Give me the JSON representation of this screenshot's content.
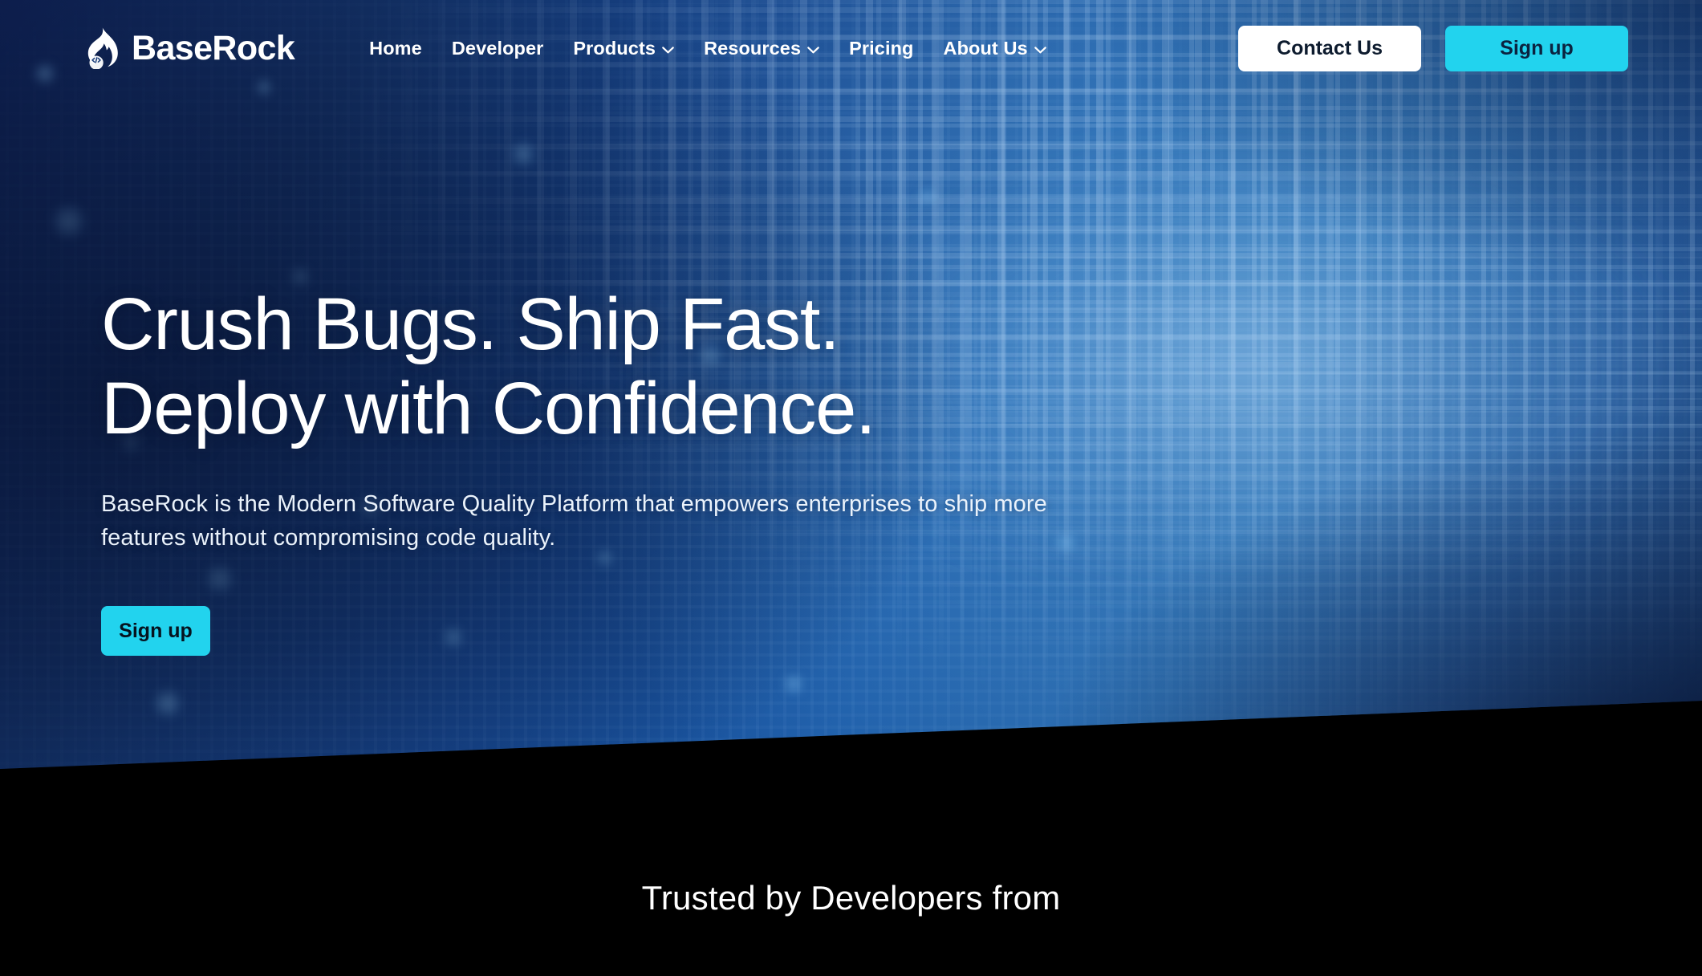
{
  "brand": {
    "name": "BaseRock",
    "logo_icon": "flame-code-logo-icon"
  },
  "nav": {
    "items": [
      {
        "label": "Home",
        "has_dropdown": false
      },
      {
        "label": "Developer",
        "has_dropdown": false
      },
      {
        "label": "Products",
        "has_dropdown": true
      },
      {
        "label": "Resources",
        "has_dropdown": true
      },
      {
        "label": "Pricing",
        "has_dropdown": false
      },
      {
        "label": "About Us",
        "has_dropdown": true
      }
    ],
    "dropdown_icon": "chevron-down-icon"
  },
  "header_actions": {
    "contact_label": "Contact Us",
    "signup_label": "Sign up"
  },
  "hero": {
    "headline_line1": "Crush Bugs. Ship Fast.",
    "headline_line2": "Deploy with Confidence.",
    "subhead": "BaseRock is the Modern Software Quality Platform that empowers enterprises to ship more features without compromising code quality.",
    "cta_label": "Sign up"
  },
  "trusted": {
    "title": "Trusted by Developers from"
  },
  "colors": {
    "accent_cyan": "#22d3ee",
    "hero_navy_dark": "#0e2052",
    "hero_blue_mid": "#16458c",
    "hero_blue_light": "#1f5fa6",
    "section_black": "#000000",
    "text_white": "#ffffff",
    "button_text_dark": "#0b2340"
  }
}
